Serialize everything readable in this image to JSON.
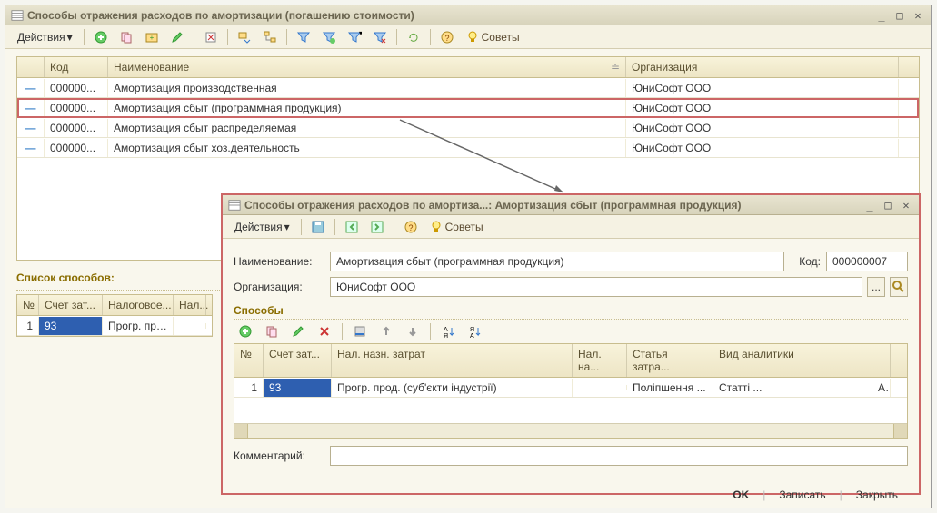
{
  "mainWindow": {
    "title": "Способы отражения расходов по амортизации (погашению стоимости)",
    "toolbar": {
      "actions": "Действия",
      "tips": "Советы"
    },
    "grid": {
      "headers": {
        "code": "Код",
        "name": "Наименование",
        "org": "Организация"
      },
      "rows": [
        {
          "code": "000000...",
          "name": "Амортизация производственная",
          "org": "ЮниСофт ООО"
        },
        {
          "code": "000000...",
          "name": "Амортизация сбыт (программная продукция)",
          "org": "ЮниСофт ООО"
        },
        {
          "code": "000000...",
          "name": "Амортизация сбыт распределяемая",
          "org": "ЮниСофт ООО"
        },
        {
          "code": "000000...",
          "name": "Амортизация сбыт хоз.деятельность",
          "org": "ЮниСофт ООО"
        }
      ]
    },
    "waysSection": {
      "title": "Список способов:",
      "headers": {
        "n": "№",
        "acc": "Счет зат...",
        "tax": "Налоговое...",
        "last": "Нал..."
      },
      "row": {
        "n": "1",
        "acc": "93",
        "tax": "Прогр. про..."
      }
    }
  },
  "childWindow": {
    "title": "Способы отражения расходов по амортиза...: Амортизация сбыт (программная продукция)",
    "toolbar": {
      "actions": "Действия",
      "tips": "Советы"
    },
    "form": {
      "nameLabel": "Наименование:",
      "nameValue": "Амортизация сбыт (программная продукция)",
      "codeLabel": "Код:",
      "codeValue": "000000007",
      "orgLabel": "Организация:",
      "orgValue": "ЮниСофт ООО",
      "waysTitle": "Способы",
      "commentLabel": "Комментарий:",
      "commentValue": ""
    },
    "grid": {
      "headers": {
        "n": "№",
        "acc": "Счет зат...",
        "tax": "Нал. назн. затрат",
        "na": "Нал. на...",
        "art": "Статья затра...",
        "an": "Вид аналитики"
      },
      "row": {
        "n": "1",
        "acc": "93",
        "tax": "Прогр. прод. (суб'єкти індустрії)",
        "na": "",
        "art": "Поліпшення ...",
        "an": "Статті ...",
        "last": "А"
      }
    },
    "buttons": {
      "ok": "OK",
      "save": "Записать",
      "close": "Закрыть"
    }
  }
}
